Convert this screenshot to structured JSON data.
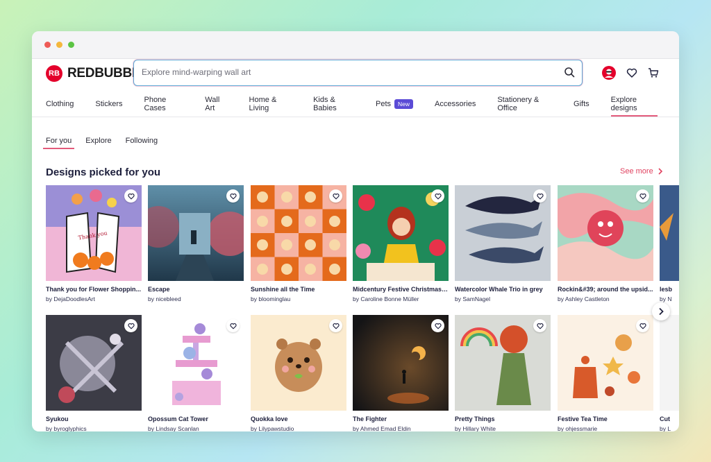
{
  "brand": {
    "name": "REDBUBBLE",
    "mark": "RB",
    "color": "#e4002b"
  },
  "search": {
    "placeholder": "Explore mind-warping wall art"
  },
  "nav": [
    {
      "label": "Clothing"
    },
    {
      "label": "Stickers"
    },
    {
      "label": "Phone Cases"
    },
    {
      "label": "Wall Art"
    },
    {
      "label": "Home & Living"
    },
    {
      "label": "Kids & Babies"
    },
    {
      "label": "Pets",
      "badge": "New"
    },
    {
      "label": "Accessories"
    },
    {
      "label": "Stationery & Office"
    },
    {
      "label": "Gifts"
    },
    {
      "label": "Explore designs",
      "active": true
    }
  ],
  "subtabs": [
    "For you",
    "Explore",
    "Following"
  ],
  "section": {
    "title": "Designs picked for you",
    "see_more": "See more"
  },
  "row1": [
    {
      "title": "Thank you for Flower Shoppin...",
      "artist": "by DejaDoodlesArt"
    },
    {
      "title": "Escape",
      "artist": "by nicebleed"
    },
    {
      "title": "Sunshine all the Time",
      "artist": "by bloominglau"
    },
    {
      "title": "Midcentury Festive Christmas ...",
      "artist": "by Caroline Bonne Müller"
    },
    {
      "title": "Watercolor Whale Trio in grey",
      "artist": "by SamNagel"
    },
    {
      "title": "Rockin&#39; around the upsid...",
      "artist": "by Ashley Castleton"
    },
    {
      "title": "lesb",
      "artist": "by N"
    }
  ],
  "row2": [
    {
      "title": "Syukou",
      "artist": "by byroglyphics"
    },
    {
      "title": "Opossum Cat Tower",
      "artist": "by Lindsay Scanlan"
    },
    {
      "title": "Quokka love",
      "artist": "by Lilypawstudio"
    },
    {
      "title": "The Fighter",
      "artist": "by Ahmed Emad Eldin"
    },
    {
      "title": "Pretty Things",
      "artist": "by Hillary White"
    },
    {
      "title": "Festive Tea Time",
      "artist": "by ohjessmarie"
    },
    {
      "title": "Cut",
      "artist": "by L"
    }
  ],
  "icons": {
    "search": "search-icon",
    "account": "avatar-icon",
    "wishlist": "heart-icon",
    "cart": "cart-icon",
    "next": "chevron-right-icon"
  },
  "colors": {
    "accent": "#e35a7b",
    "badge": "#5b4bd6",
    "link": "#e0415f"
  }
}
